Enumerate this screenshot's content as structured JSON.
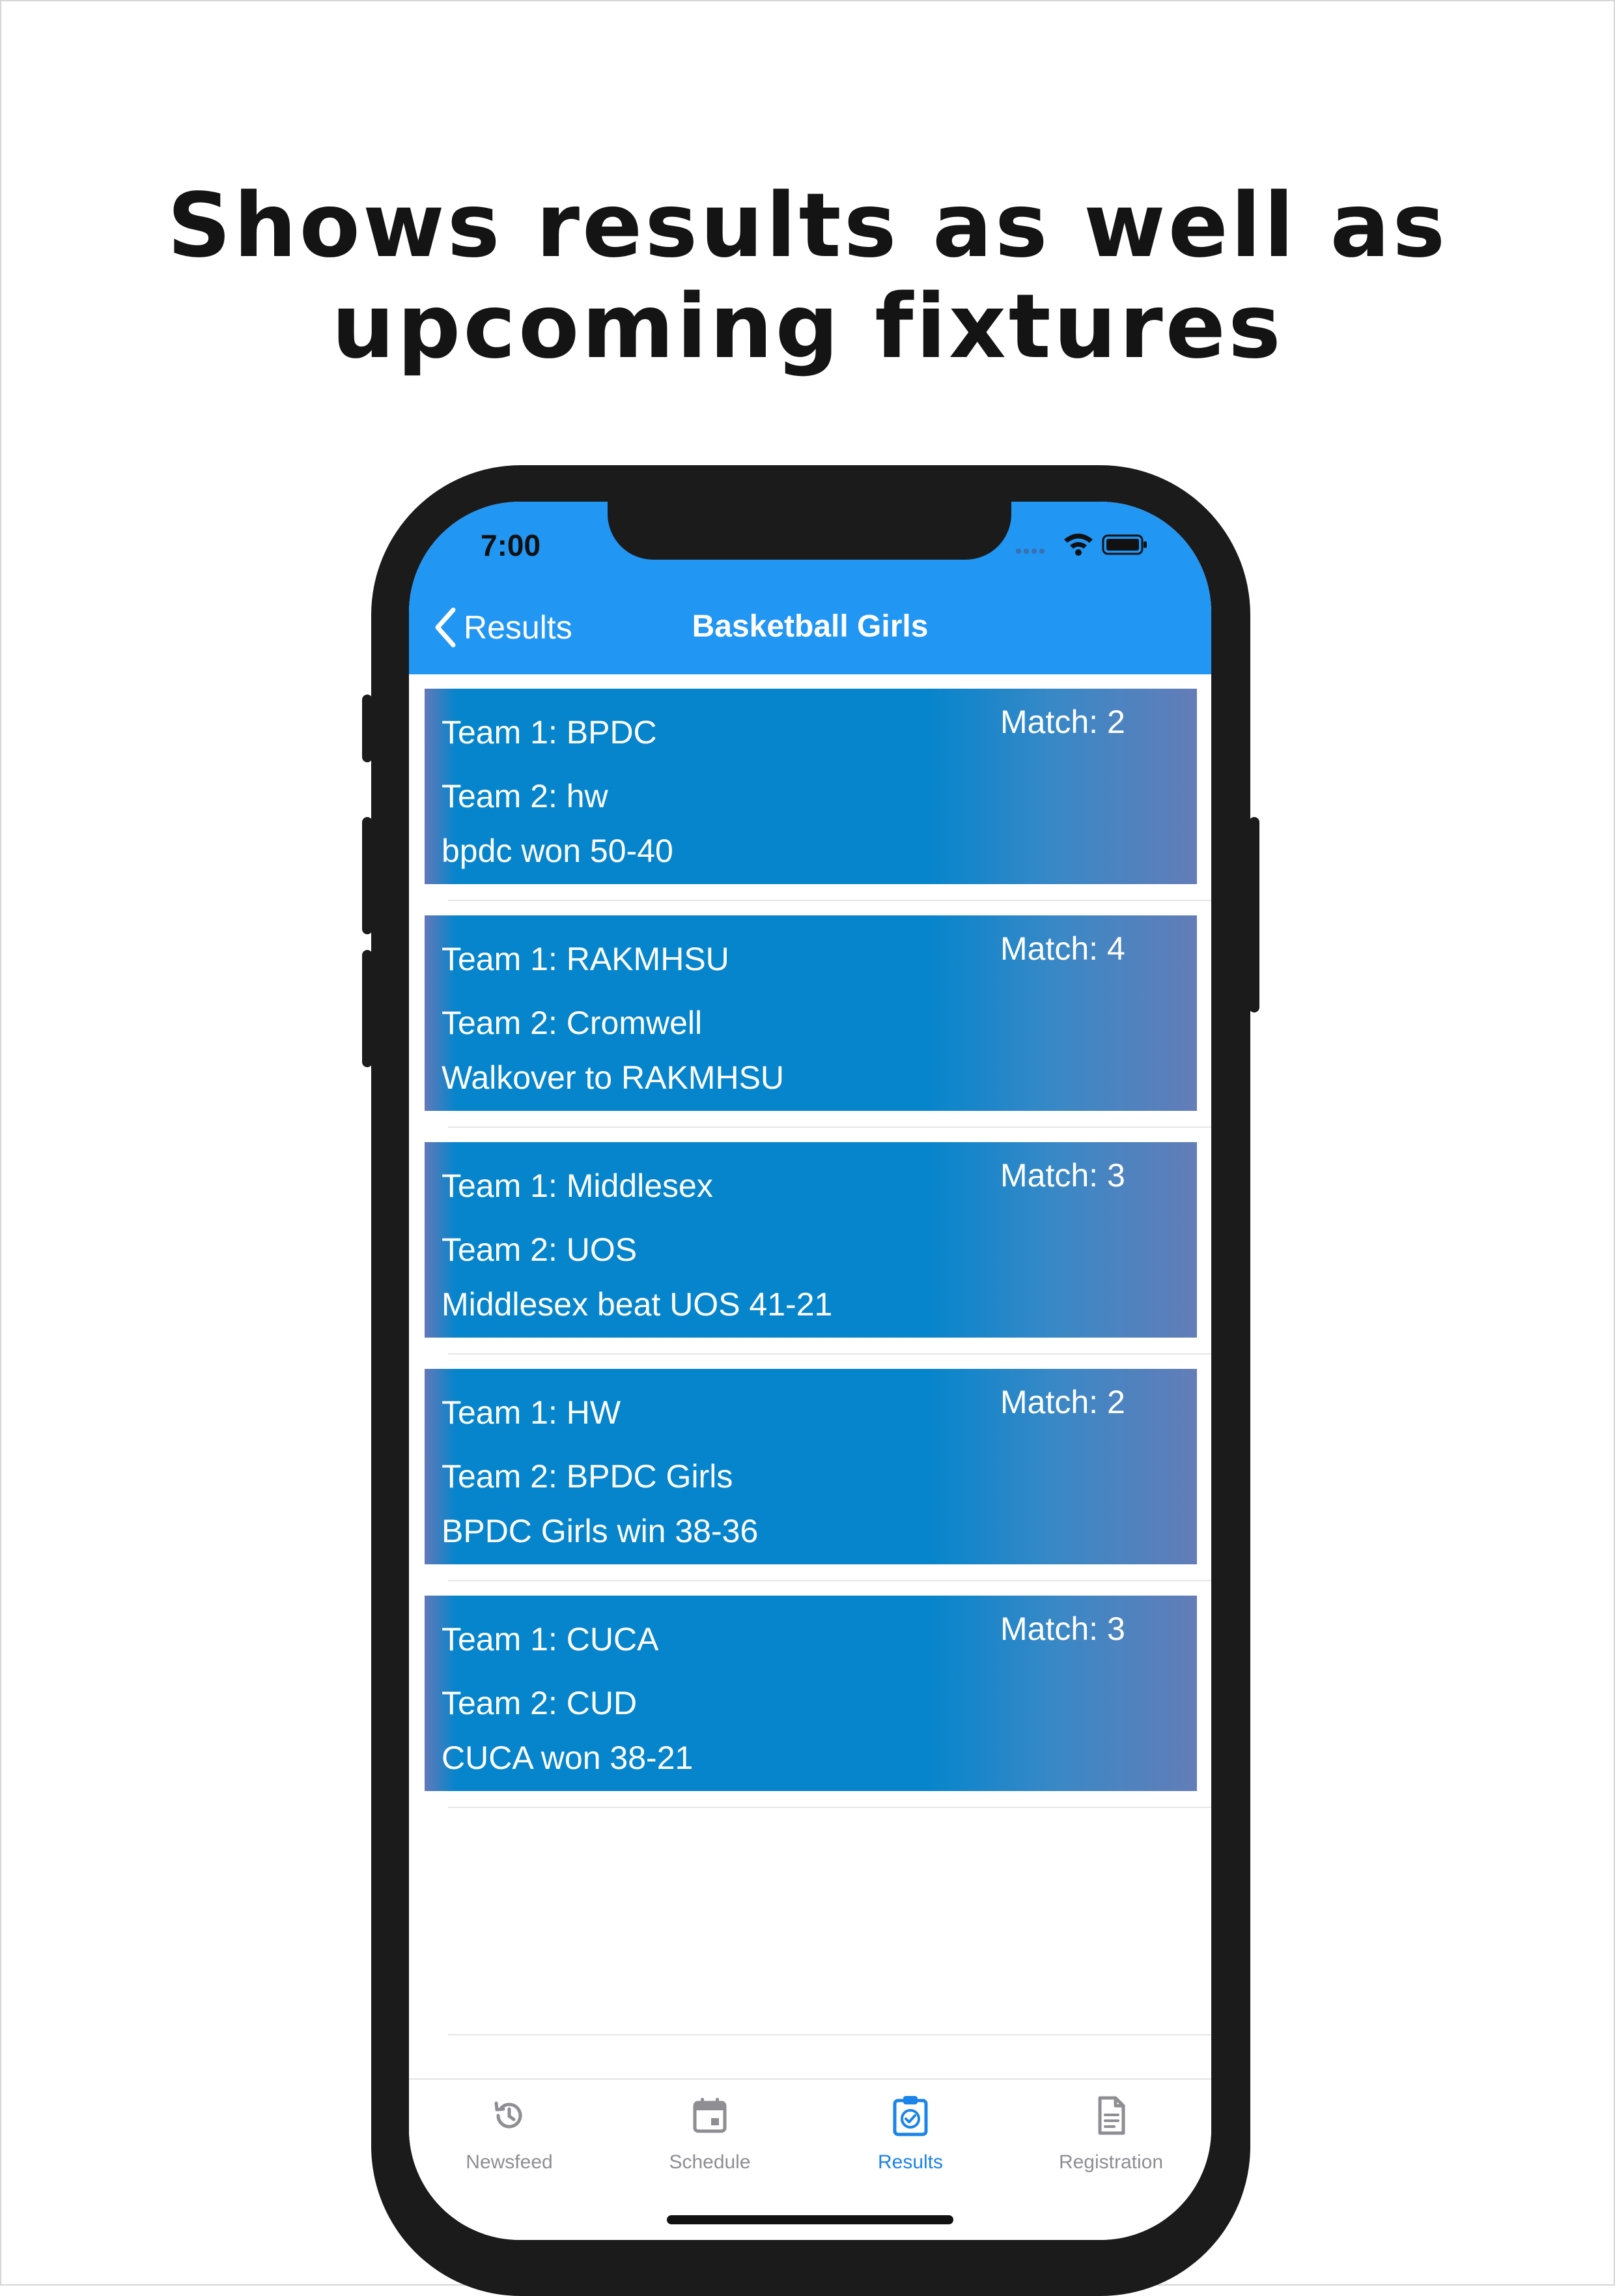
{
  "headline": {
    "line1": "Shows results as well as",
    "line2": "upcoming fixtures"
  },
  "status_bar": {
    "time": "7:00"
  },
  "nav": {
    "back_label": "Results",
    "title": "Basketball Girls"
  },
  "results": [
    {
      "team1": "Team 1: BPDC",
      "team2": "Team 2: hw",
      "result": "bpdc won 50-40",
      "match": "Match: 2"
    },
    {
      "team1": "Team 1: RAKMHSU",
      "team2": "Team 2: Cromwell",
      "result": "Walkover to RAKMHSU",
      "match": "Match: 4"
    },
    {
      "team1": "Team 1: Middlesex",
      "team2": "Team 2: UOS",
      "result": "Middlesex beat UOS 41-21",
      "match": "Match: 3"
    },
    {
      "team1": "Team 1: HW",
      "team2": "Team 2: BPDC Girls",
      "result": "BPDC Girls win 38-36",
      "match": "Match: 2"
    },
    {
      "team1": "Team 1: CUCA",
      "team2": "Team 2: CUD",
      "result": "CUCA won 38-21",
      "match": "Match: 3"
    }
  ],
  "tabs": [
    {
      "label": "Newsfeed",
      "icon": "history-icon",
      "active": false
    },
    {
      "label": "Schedule",
      "icon": "calendar-icon",
      "active": false
    },
    {
      "label": "Results",
      "icon": "clipboard-check-icon",
      "active": true
    },
    {
      "label": "Registration",
      "icon": "document-icon",
      "active": false
    }
  ],
  "colors": {
    "accent": "#2196f3",
    "card": "#0685cc",
    "card_edge": "#637db8",
    "active_tab": "#1a84e8",
    "inactive_tab": "#8e8e93"
  }
}
